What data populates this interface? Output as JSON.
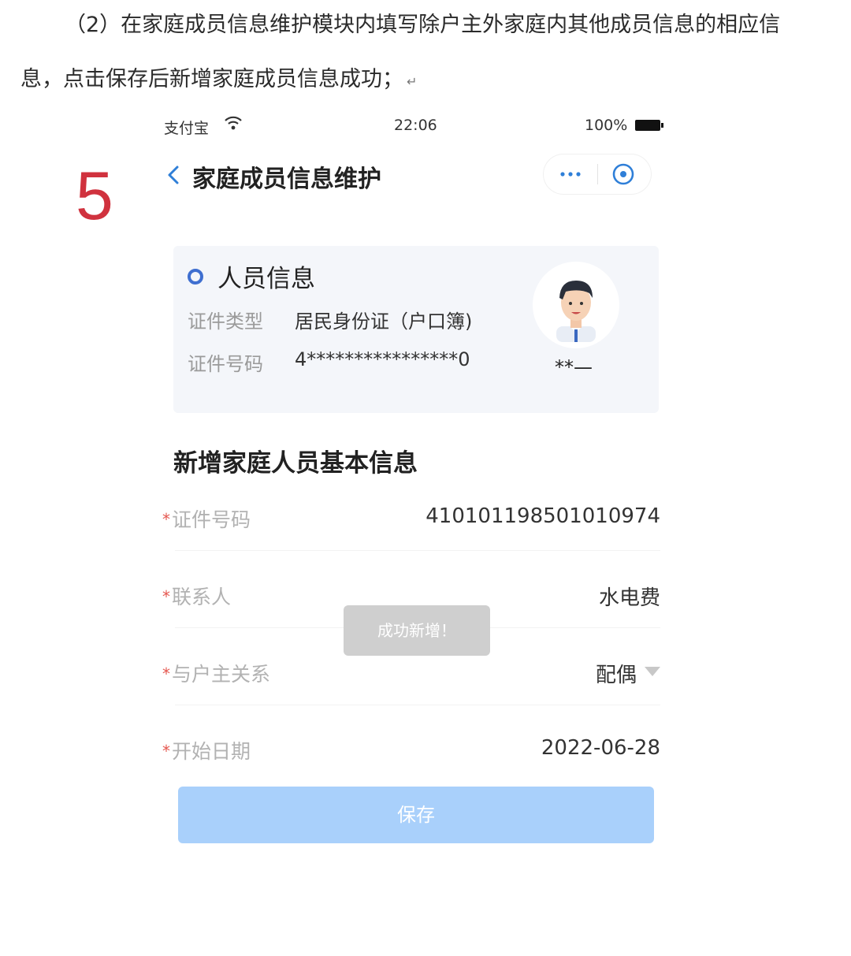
{
  "instruction": {
    "line1": "（2）在家庭成员信息维护模块内填写除户主外家庭内其他成员信息的相应信",
    "line2": "息，点击保存后新增家庭成员信息成功；",
    "return_mark": "↵"
  },
  "step_number": "5",
  "status_bar": {
    "carrier": "支付宝",
    "time": "22:06",
    "battery": "100%"
  },
  "nav": {
    "title": "家庭成员信息维护"
  },
  "person_card": {
    "title": "人员信息",
    "id_type_label": "证件类型",
    "id_type_value": "居民身份证（户口簿)",
    "id_number_label": "证件号码",
    "id_number_value": "4****************0",
    "name_masked": "**—"
  },
  "form": {
    "section_title": "新增家庭人员基本信息",
    "required_mark": "*",
    "fields": [
      {
        "label": "证件号码",
        "value": "410101198501010974"
      },
      {
        "label": "联系人",
        "value": "水电费"
      },
      {
        "label": "与户主关系",
        "value": "配偶"
      },
      {
        "label": "开始日期",
        "value": "2022-06-28"
      }
    ]
  },
  "toast": "成功新增！",
  "save_button": "保存",
  "colors": {
    "accent_blue": "#3f6fd0",
    "save_button_bg": "#a9d0fb",
    "step_red": "#d0323e",
    "required_red": "#e5574f"
  },
  "icons": [
    "wifi-icon",
    "battery-icon",
    "back-arrow-icon",
    "more-dots-icon",
    "close-target-icon",
    "avatar-icon",
    "dropdown-caret-icon"
  ]
}
